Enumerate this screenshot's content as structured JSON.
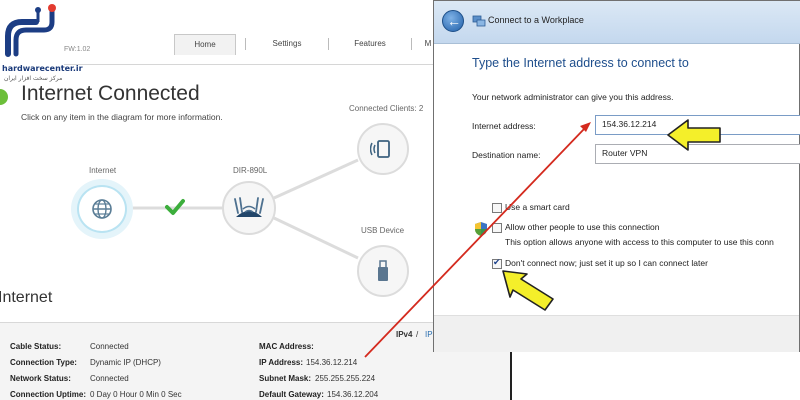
{
  "brand": {
    "name": "hardwarecenter.ir",
    "tagline": "مرکز سخت افزار ایران"
  },
  "router": {
    "firmware": "FW:1.02",
    "nav": [
      "Home",
      "Settings",
      "Features",
      "M"
    ],
    "status_title": "Internet Connected",
    "status_hint": "Click on any item in the diagram for more information.",
    "diagram": {
      "internet_label": "Internet",
      "router_label": "DIR-890L",
      "clients_label": "Connected Clients: 2",
      "usb_label": "USB Device"
    },
    "section_title": "Internet",
    "ipv": {
      "ipv4": "IPv4",
      "sep": "/",
      "ipv6": "IP"
    },
    "details_left": [
      {
        "label": "Cable Status:",
        "value": "Connected"
      },
      {
        "label": "Connection Type:",
        "value": "Dynamic IP (DHCP)"
      },
      {
        "label": "Network Status:",
        "value": "Connected"
      },
      {
        "label": "Connection Uptime:",
        "value": "0 Day 0 Hour 0 Min 0 Sec"
      }
    ],
    "details_right": [
      {
        "label": "MAC Address:",
        "value": ""
      },
      {
        "label": "IP Address:",
        "value": "154.36.12.214"
      },
      {
        "label": "Subnet Mask:",
        "value": "255.255.255.224"
      },
      {
        "label": "Default Gateway:",
        "value": "154.36.12.204"
      }
    ]
  },
  "dialog": {
    "window_title": "Connect to a Workplace",
    "heading": "Type the Internet address to connect to",
    "intro": "Your network administrator can give you this address.",
    "internet_address_label": "Internet address:",
    "internet_address_value": "154.36.12.214",
    "destination_label": "Destination name:",
    "destination_value": "Router VPN",
    "smart_card_label": "Use a smart card",
    "allow_others_label": "Allow other people to use this connection",
    "allow_others_desc": "This option allows anyone with access to this computer to use this conn",
    "dont_connect_label": "Don't connect now; just set it up so I can connect later",
    "smart_card_checked": false,
    "allow_others_checked": false,
    "dont_connect_checked": true
  },
  "colors": {
    "accent_green": "#6cbf3a",
    "arrow_red": "#d42a1e",
    "callout_yellow": "#f4ef2a",
    "heading_blue": "#1e4e8c"
  }
}
